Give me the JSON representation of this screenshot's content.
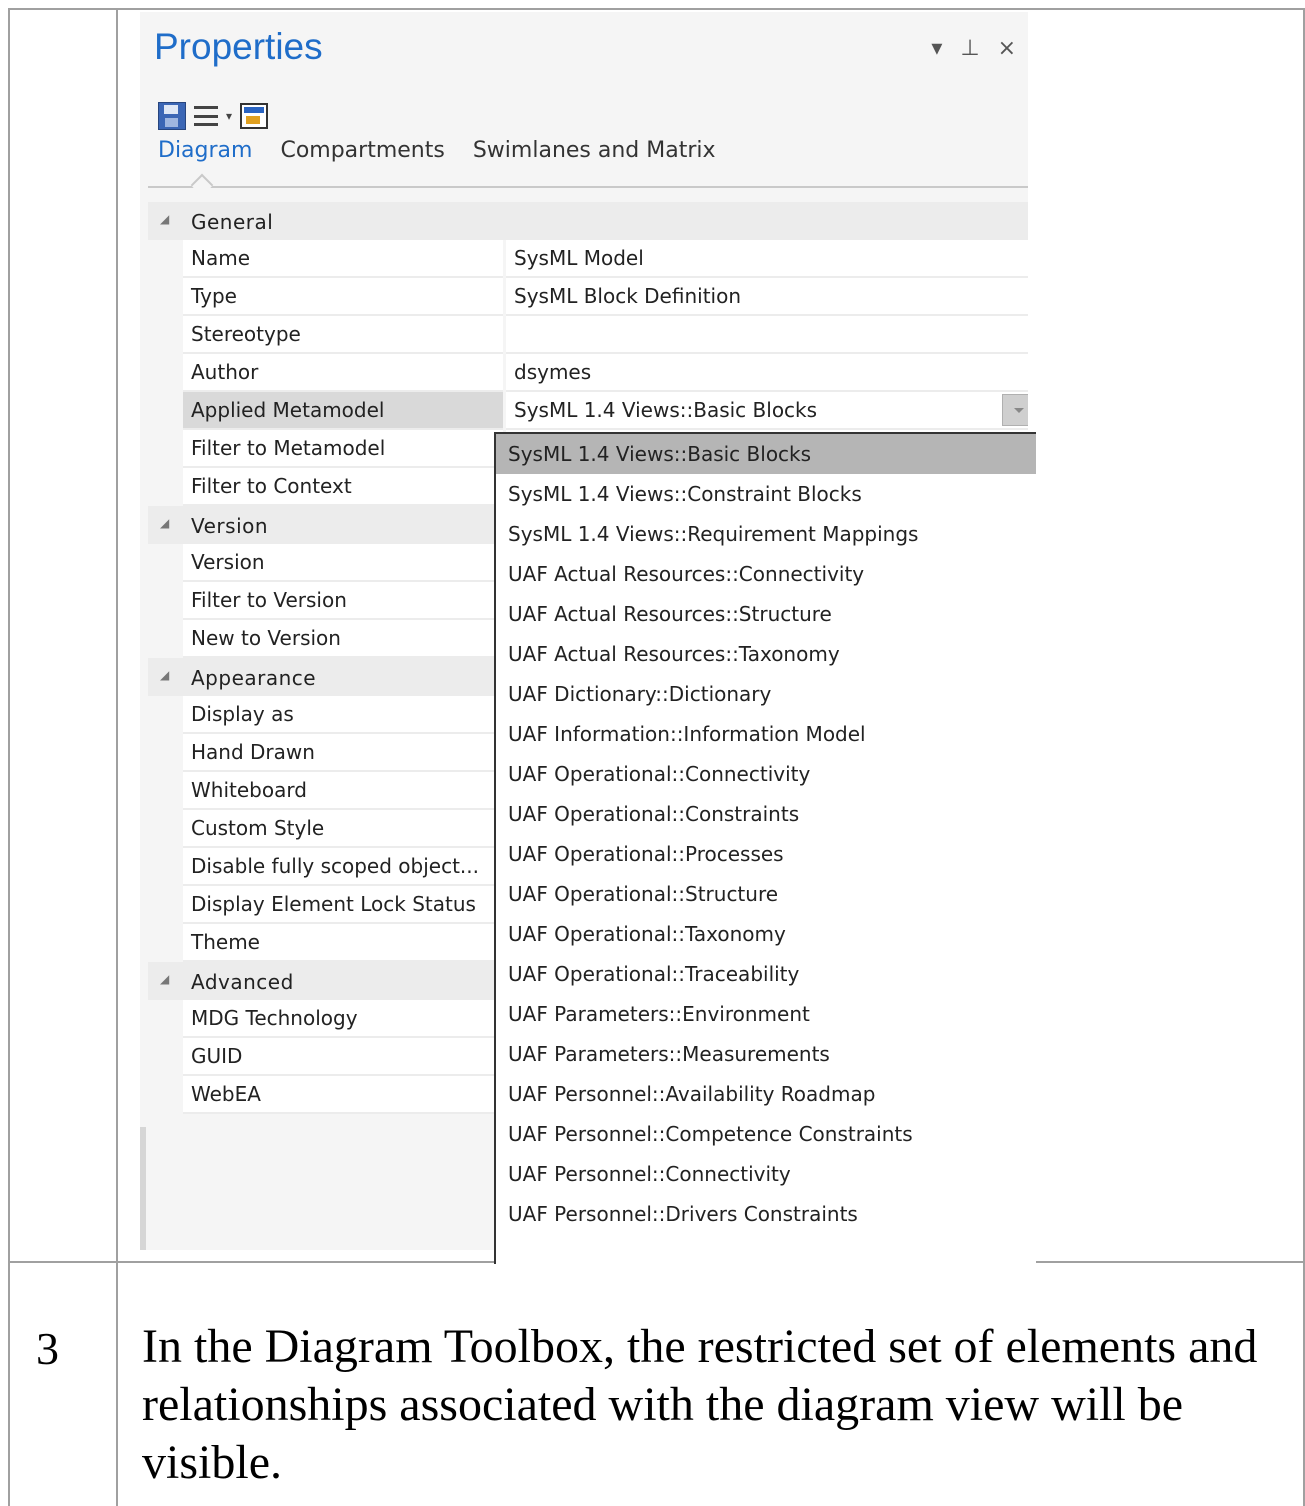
{
  "panel": {
    "title": "Properties",
    "controls": {
      "dropdown": "▾",
      "pin": "⊥",
      "close": "×"
    }
  },
  "tabs": [
    {
      "label": "Diagram",
      "active": true
    },
    {
      "label": "Compartments",
      "active": false
    },
    {
      "label": "Swimlanes and Matrix",
      "active": false
    }
  ],
  "groups": {
    "general": "General",
    "version": "Version",
    "appearance": "Appearance",
    "advanced": "Advanced"
  },
  "props": {
    "name": {
      "label": "Name",
      "value": "SysML Model"
    },
    "type": {
      "label": "Type",
      "value": "SysML Block Definition"
    },
    "stereotype": {
      "label": "Stereotype",
      "value": ""
    },
    "author": {
      "label": "Author",
      "value": "dsymes"
    },
    "applied_metamodel": {
      "label": "Applied Metamodel",
      "value": "SysML 1.4 Views::Basic Blocks"
    },
    "filter_metamodel": {
      "label": "Filter to Metamodel"
    },
    "filter_context": {
      "label": "Filter to Context"
    },
    "version": {
      "label": "Version"
    },
    "filter_version": {
      "label": "Filter to Version"
    },
    "new_version": {
      "label": "New to Version"
    },
    "display_as": {
      "label": "Display as"
    },
    "hand_drawn": {
      "label": "Hand Drawn"
    },
    "whiteboard": {
      "label": "Whiteboard"
    },
    "custom_style": {
      "label": "Custom Style"
    },
    "disable_scoped": {
      "label": "Disable fully scoped object..."
    },
    "lock_status": {
      "label": "Display Element Lock Status"
    },
    "theme": {
      "label": "Theme"
    },
    "mdg": {
      "label": "MDG Technology"
    },
    "guid": {
      "label": "GUID"
    },
    "webea": {
      "label": "WebEA"
    }
  },
  "dropdown_options": [
    "SysML 1.4 Views::Basic Blocks",
    "SysML 1.4 Views::Constraint Blocks",
    "SysML 1.4 Views::Requirement Mappings",
    "UAF Actual Resources::Connectivity",
    "UAF Actual Resources::Structure",
    "UAF Actual Resources::Taxonomy",
    "UAF Dictionary::Dictionary",
    "UAF Information::Information Model",
    "UAF Operational::Connectivity",
    "UAF Operational::Constraints",
    "UAF Operational::Processes",
    "UAF Operational::Structure",
    "UAF Operational::Taxonomy",
    "UAF Operational::Traceability",
    "UAF Parameters::Environment",
    "UAF Parameters::Measurements",
    "UAF Personnel::Availability Roadmap",
    "UAF Personnel::Competence Constraints",
    "UAF Personnel::Connectivity",
    "UAF Personnel::Drivers Constraints"
  ],
  "step": {
    "number": "3",
    "text": "In the Diagram Toolbox, the restricted set of elements and relationships associated with the diagram view will be visible."
  },
  "colors": {
    "accent": "#1f6dc9",
    "highlight": "#b5b5b5"
  }
}
